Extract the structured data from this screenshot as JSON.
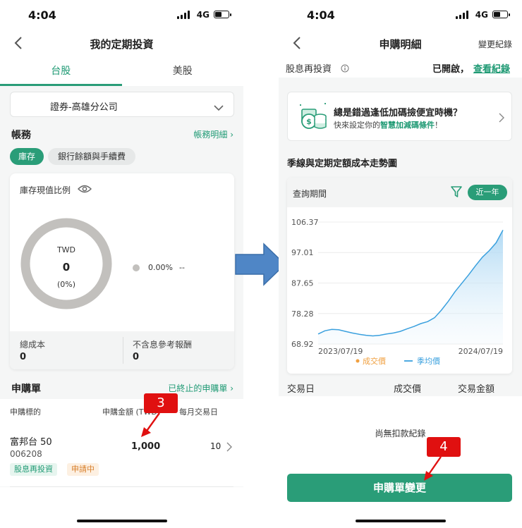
{
  "left": {
    "status": {
      "time": "4:04",
      "network": "4G"
    },
    "nav": {
      "title": "我的定期投資"
    },
    "tabs": [
      {
        "label": "台股"
      },
      {
        "label": "美股"
      }
    ],
    "broker": {
      "label": "證券-高雄分公司"
    },
    "account": {
      "title": "帳務",
      "detail_link": "帳務明細",
      "chips": [
        {
          "label": "庫存"
        },
        {
          "label": "銀行餘額與手續費"
        }
      ]
    },
    "holdings": {
      "title": "庫存現值比例",
      "donut_currency": "TWD",
      "donut_value": "0",
      "donut_percent": "(0%)",
      "legend_percent": "0.00%",
      "legend_name": "--",
      "total_cost_label": "總成本",
      "total_cost_value": "0",
      "return_label": "不含息參考報酬",
      "return_value": "0"
    },
    "orders": {
      "title": "申購單",
      "terminated_link": "已終止的申購單",
      "columns": {
        "target": "申購標的",
        "amount": "申購金額 (TWD)",
        "day": "每月交易日"
      },
      "rows": [
        {
          "name": "富邦台 50",
          "code": "006208",
          "amount": "1,000",
          "day": "10",
          "tags": [
            "股息再投資",
            "申請中"
          ]
        }
      ]
    },
    "annotation": "3"
  },
  "right": {
    "status": {
      "time": "4:04",
      "network": "4G"
    },
    "nav": {
      "title": "申購明細",
      "action": "變更紀錄"
    },
    "dividend": {
      "label": "股息再投資",
      "status": "已開啟，",
      "link": "查看紀錄"
    },
    "promo": {
      "title": "總是錯過逢低加碼撿便宜時機？",
      "subtitle_prefix": "快來設定你的",
      "subtitle_link": "智慧加減碼條件",
      "subtitle_suffix": "！"
    },
    "chart_section": {
      "title": "季線與定期定額成本走勢圖",
      "query_label": "查詢期間",
      "period_chip": "近一年"
    },
    "chart_data": {
      "type": "area",
      "x": [
        "2023/07/19",
        "2024/07/19"
      ],
      "x_ticks": [
        "2023/07/19",
        "2024/07/19"
      ],
      "y_ticks": [
        "106.37",
        "97.01",
        "87.65",
        "78.28",
        "68.92"
      ],
      "ylim": [
        68.92,
        106.37
      ],
      "legend": [
        {
          "label": "成交價",
          "color": "#f0a040"
        },
        {
          "label": "季均價",
          "color": "#3aa0de"
        }
      ],
      "series": [
        {
          "name": "季均價",
          "values": [
            72.0,
            73.0,
            73.4,
            73.3,
            72.8,
            72.3,
            71.9,
            71.6,
            71.4,
            71.6,
            72.0,
            72.3,
            72.8,
            73.6,
            74.3,
            75.2,
            75.8,
            77.0,
            79.3,
            82.0,
            85.0,
            87.6,
            90.2,
            93.0,
            95.6,
            97.6,
            100.0,
            103.9
          ]
        }
      ]
    },
    "table": {
      "col_date": "交易日",
      "col_price": "成交價",
      "col_amount": "交易金額",
      "empty": "尚無扣款紀錄"
    },
    "button": {
      "label": "申購單變更"
    },
    "annotation": "4"
  }
}
